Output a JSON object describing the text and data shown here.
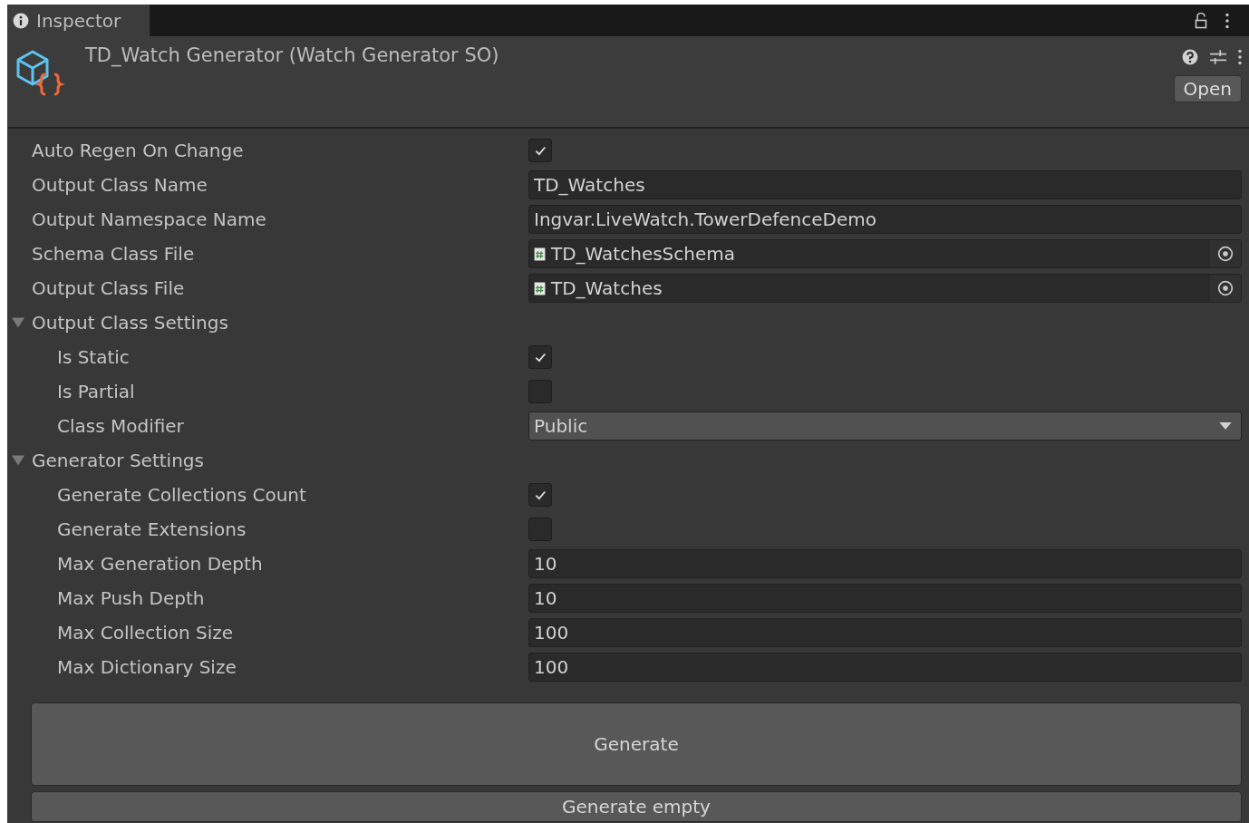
{
  "window": {
    "tab": {
      "label": "Inspector",
      "selected": true
    }
  },
  "header": {
    "title": "TD_Watch Generator (Watch Generator SO)",
    "open_button": "Open"
  },
  "properties": [
    {
      "kind": "checkbox",
      "label": "Auto Regen On Change",
      "checked": true
    },
    {
      "kind": "text",
      "label": "Output Class Name",
      "value": "TD_Watches"
    },
    {
      "kind": "text",
      "label": "Output Namespace Name",
      "value": "Ingvar.LiveWatch.TowerDefenceDemo"
    },
    {
      "kind": "object",
      "label": "Schema Class File",
      "value": "TD_WatchesSchema"
    },
    {
      "kind": "object",
      "label": "Output Class File",
      "value": "TD_Watches"
    },
    {
      "kind": "foldout",
      "label": "Output Class Settings",
      "expanded": true,
      "children": [
        {
          "kind": "checkbox",
          "label": "Is Static",
          "checked": true
        },
        {
          "kind": "checkbox",
          "label": "Is Partial",
          "checked": false
        },
        {
          "kind": "dropdown",
          "label": "Class Modifier",
          "value": "Public"
        }
      ]
    },
    {
      "kind": "foldout",
      "label": "Generator Settings",
      "expanded": true,
      "children": [
        {
          "kind": "checkbox",
          "label": "Generate Collections Count",
          "checked": true
        },
        {
          "kind": "checkbox",
          "label": "Generate Extensions",
          "checked": false
        },
        {
          "kind": "text",
          "label": "Max Generation Depth",
          "value": "10"
        },
        {
          "kind": "text",
          "label": "Max Push Depth",
          "value": "10"
        },
        {
          "kind": "text",
          "label": "Max Collection Size",
          "value": "100"
        },
        {
          "kind": "text",
          "label": "Max Dictionary Size",
          "value": "100"
        }
      ]
    }
  ],
  "buttons": [
    {
      "kind": "large",
      "label": "Generate"
    },
    {
      "kind": "small",
      "label": "Generate empty"
    }
  ]
}
